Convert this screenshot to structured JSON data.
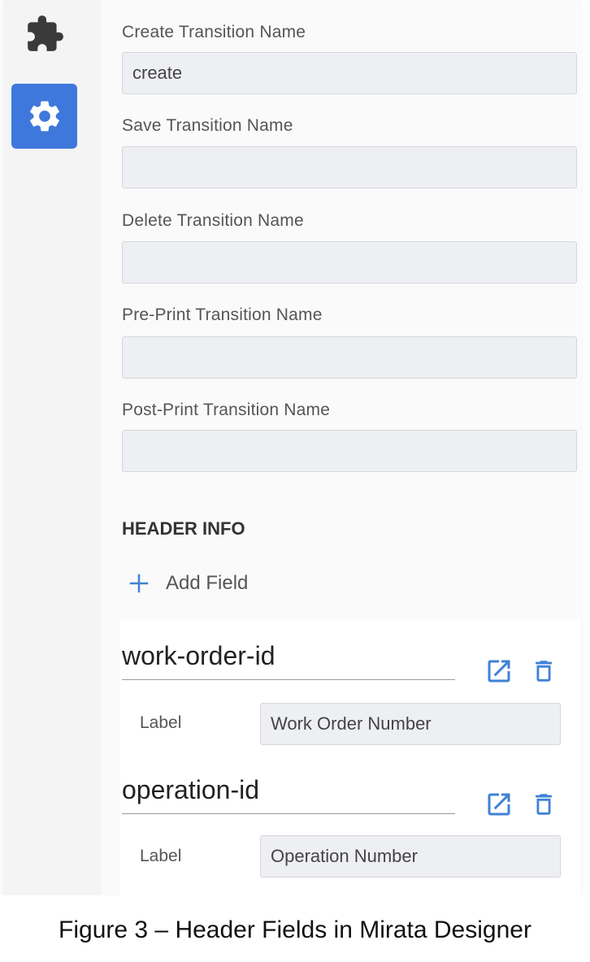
{
  "sidebar": {
    "items": [
      {
        "icon": "puzzle-icon",
        "active": false
      },
      {
        "icon": "gear-icon",
        "active": true
      }
    ]
  },
  "transitions": [
    {
      "label": "Create Transition Name",
      "value": "create"
    },
    {
      "label": "Save Transition Name",
      "value": ""
    },
    {
      "label": "Delete Transition Name",
      "value": ""
    },
    {
      "label": "Pre-Print Transition Name",
      "value": ""
    },
    {
      "label": "Post-Print Transition Name",
      "value": ""
    }
  ],
  "header_info": {
    "title": "HEADER INFO",
    "add_field_label": "Add Field",
    "fields": [
      {
        "name": "work-order-id",
        "label_caption": "Label",
        "label_value": "Work Order Number"
      },
      {
        "name": "operation-id",
        "label_caption": "Label",
        "label_value": "Operation Number"
      }
    ]
  },
  "caption": "Figure 3 – Header Fields in Mirata Designer",
  "colors": {
    "accent": "#3f78dc",
    "icon_blue": "#3f82d6",
    "input_bg": "#eeeff2"
  }
}
